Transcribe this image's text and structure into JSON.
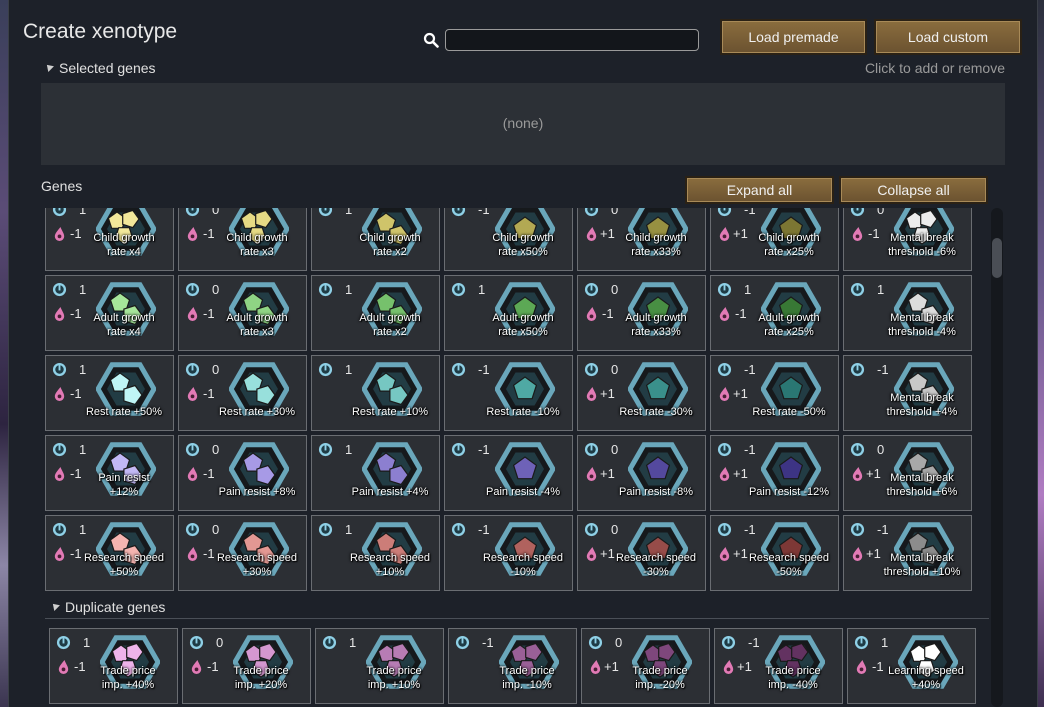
{
  "window": {
    "title": "Create xenotype",
    "search": {
      "placeholder": "",
      "value": ""
    },
    "buttons": {
      "load_premade": "Load premade",
      "load_custom": "Load custom",
      "expand_all": "Expand all",
      "collapse_all": "Collapse all"
    },
    "selected_header": "Selected genes",
    "hint": "Click to add or remove",
    "selected_empty": "(none)",
    "genes_label": "Genes",
    "duplicate_header": "Duplicate genes"
  },
  "icons": {
    "complexity": "complexity-icon",
    "metabolism": "metabolism-icon",
    "search": "search-icon"
  },
  "colors": {
    "accent_button": "#7a5e35",
    "complexity_icon": "#8fd0e6",
    "metabolism_icon": "#e27ab5",
    "hex_frame": "#6aa7bb"
  },
  "gene_rows": [
    {
      "name": "child-growth",
      "visible_fraction": 0.8,
      "cards": [
        {
          "complexity": "1",
          "metabolism": "-1",
          "label": [
            "Child growth",
            "rate x4"
          ],
          "color": "#f2e89a"
        },
        {
          "complexity": "0",
          "metabolism": "-1",
          "label": [
            "Child growth",
            "rate x3"
          ],
          "color": "#e6da84"
        },
        {
          "complexity": "1",
          "metabolism": "",
          "label": [
            "Child growth",
            "rate x2"
          ],
          "color": "#cfc46a"
        },
        {
          "complexity": "-1",
          "metabolism": "",
          "label": [
            "Child growth",
            "rate x50%"
          ],
          "color": "#b2a953"
        },
        {
          "complexity": "0",
          "metabolism": "+1",
          "label": [
            "Child growth",
            "rate x33%"
          ],
          "color": "#979041"
        },
        {
          "complexity": "-1",
          "metabolism": "+1",
          "label": [
            "Child growth",
            "rate x25%"
          ],
          "color": "#7c7633"
        },
        {
          "complexity": "0",
          "metabolism": "-1",
          "label": [
            "Mental break",
            "threshold -6%"
          ],
          "color": "#ececec"
        }
      ]
    },
    {
      "name": "adult-growth",
      "cards": [
        {
          "complexity": "1",
          "metabolism": "-1",
          "label": [
            "Adult growth",
            "rate x4"
          ],
          "color": "#a6e69a"
        },
        {
          "complexity": "0",
          "metabolism": "-1",
          "label": [
            "Adult growth",
            "rate x3"
          ],
          "color": "#8fd484"
        },
        {
          "complexity": "1",
          "metabolism": "",
          "label": [
            "Adult growth",
            "rate x2"
          ],
          "color": "#76c16c"
        },
        {
          "complexity": "1",
          "metabolism": "",
          "label": [
            "Adult growth",
            "rate x50%"
          ],
          "color": "#5ca855"
        },
        {
          "complexity": "0",
          "metabolism": "-1",
          "label": [
            "Adult growth",
            "rate x33%"
          ],
          "color": "#488f43"
        },
        {
          "complexity": "1",
          "metabolism": "-1",
          "label": [
            "Adult growth",
            "rate x25%"
          ],
          "color": "#387835"
        },
        {
          "complexity": "1",
          "metabolism": "",
          "label": [
            "Mental break",
            "threshold -4%"
          ],
          "color": "#dcdcdc"
        }
      ]
    },
    {
      "name": "rest-rate",
      "cards": [
        {
          "complexity": "1",
          "metabolism": "-1",
          "label": [
            "",
            "Rest rate +50%"
          ],
          "color": "#bff5f5"
        },
        {
          "complexity": "0",
          "metabolism": "-1",
          "label": [
            "",
            "Rest rate +30%"
          ],
          "color": "#98e0dc"
        },
        {
          "complexity": "1",
          "metabolism": "",
          "label": [
            "",
            "Rest rate +10%"
          ],
          "color": "#76c7c2"
        },
        {
          "complexity": "-1",
          "metabolism": "",
          "label": [
            "",
            "Rest rate -10%"
          ],
          "color": "#4fa9a4"
        },
        {
          "complexity": "0",
          "metabolism": "+1",
          "label": [
            "",
            "Rest rate -30%"
          ],
          "color": "#3a908b"
        },
        {
          "complexity": "-1",
          "metabolism": "+1",
          "label": [
            "",
            "Rest rate -50%"
          ],
          "color": "#2a7773"
        },
        {
          "complexity": "-1",
          "metabolism": "",
          "label": [
            "Mental break",
            "threshold +4%"
          ],
          "color": "#c8c8c8"
        }
      ]
    },
    {
      "name": "pain-resist",
      "cards": [
        {
          "complexity": "1",
          "metabolism": "-1",
          "label": [
            "Pain resist",
            "+12%"
          ],
          "color": "#c2b8f5"
        },
        {
          "complexity": "0",
          "metabolism": "-1",
          "label": [
            "",
            "Pain resist +8%"
          ],
          "color": "#a79ae6"
        },
        {
          "complexity": "1",
          "metabolism": "",
          "label": [
            "",
            "Pain resist +4%"
          ],
          "color": "#8c7fd0"
        },
        {
          "complexity": "-1",
          "metabolism": "",
          "label": [
            "",
            "Pain resist -4%"
          ],
          "color": "#6e62b8"
        },
        {
          "complexity": "0",
          "metabolism": "+1",
          "label": [
            "",
            "Pain resist -8%"
          ],
          "color": "#54499e"
        },
        {
          "complexity": "-1",
          "metabolism": "+1",
          "label": [
            "",
            "Pain resist -12%"
          ],
          "color": "#3d3484"
        },
        {
          "complexity": "0",
          "metabolism": "+1",
          "label": [
            "Mental break",
            "threshold +6%"
          ],
          "color": "#a8a8a8"
        }
      ]
    },
    {
      "name": "research-speed",
      "cards": [
        {
          "complexity": "1",
          "metabolism": "-1",
          "label": [
            "Research speed",
            "+50%"
          ],
          "color": "#f5b4b0"
        },
        {
          "complexity": "0",
          "metabolism": "-1",
          "label": [
            "Research speed",
            "+30%"
          ],
          "color": "#e39893"
        },
        {
          "complexity": "1",
          "metabolism": "",
          "label": [
            "Research speed",
            "+10%"
          ],
          "color": "#cc7d78"
        },
        {
          "complexity": "-1",
          "metabolism": "",
          "label": [
            "Research speed",
            "-10%"
          ],
          "color": "#b0625e"
        },
        {
          "complexity": "0",
          "metabolism": "+1",
          "label": [
            "Research speed",
            "-30%"
          ],
          "color": "#974c49"
        },
        {
          "complexity": "-1",
          "metabolism": "+1",
          "label": [
            "Research speed",
            "-50%"
          ],
          "color": "#7d3836"
        },
        {
          "complexity": "-1",
          "metabolism": "+1",
          "label": [
            "Mental break",
            "threshold +10%"
          ],
          "color": "#8c8c8c"
        }
      ]
    }
  ],
  "duplicate_row": {
    "name": "trade-price",
    "cards": [
      {
        "complexity": "1",
        "metabolism": "-1",
        "label": [
          "Trade price",
          "imp. +40%"
        ],
        "color": "#eeb3ea"
      },
      {
        "complexity": "0",
        "metabolism": "-1",
        "label": [
          "Trade price",
          "imp. +20%"
        ],
        "color": "#d497d0"
      },
      {
        "complexity": "1",
        "metabolism": "",
        "label": [
          "Trade price",
          "imp. +10%"
        ],
        "color": "#b77cb4"
      },
      {
        "complexity": "-1",
        "metabolism": "",
        "label": [
          "Trade price",
          "imp. -10%"
        ],
        "color": "#9a6097"
      },
      {
        "complexity": "0",
        "metabolism": "+1",
        "label": [
          "Trade price",
          "imp. -20%"
        ],
        "color": "#7e477c"
      },
      {
        "complexity": "-1",
        "metabolism": "+1",
        "label": [
          "Trade price",
          "imp. -40%"
        ],
        "color": "#633261"
      },
      {
        "complexity": "1",
        "metabolism": "-1",
        "label": [
          "Learning speed",
          "+40%"
        ],
        "color": "#ffffff"
      }
    ]
  }
}
